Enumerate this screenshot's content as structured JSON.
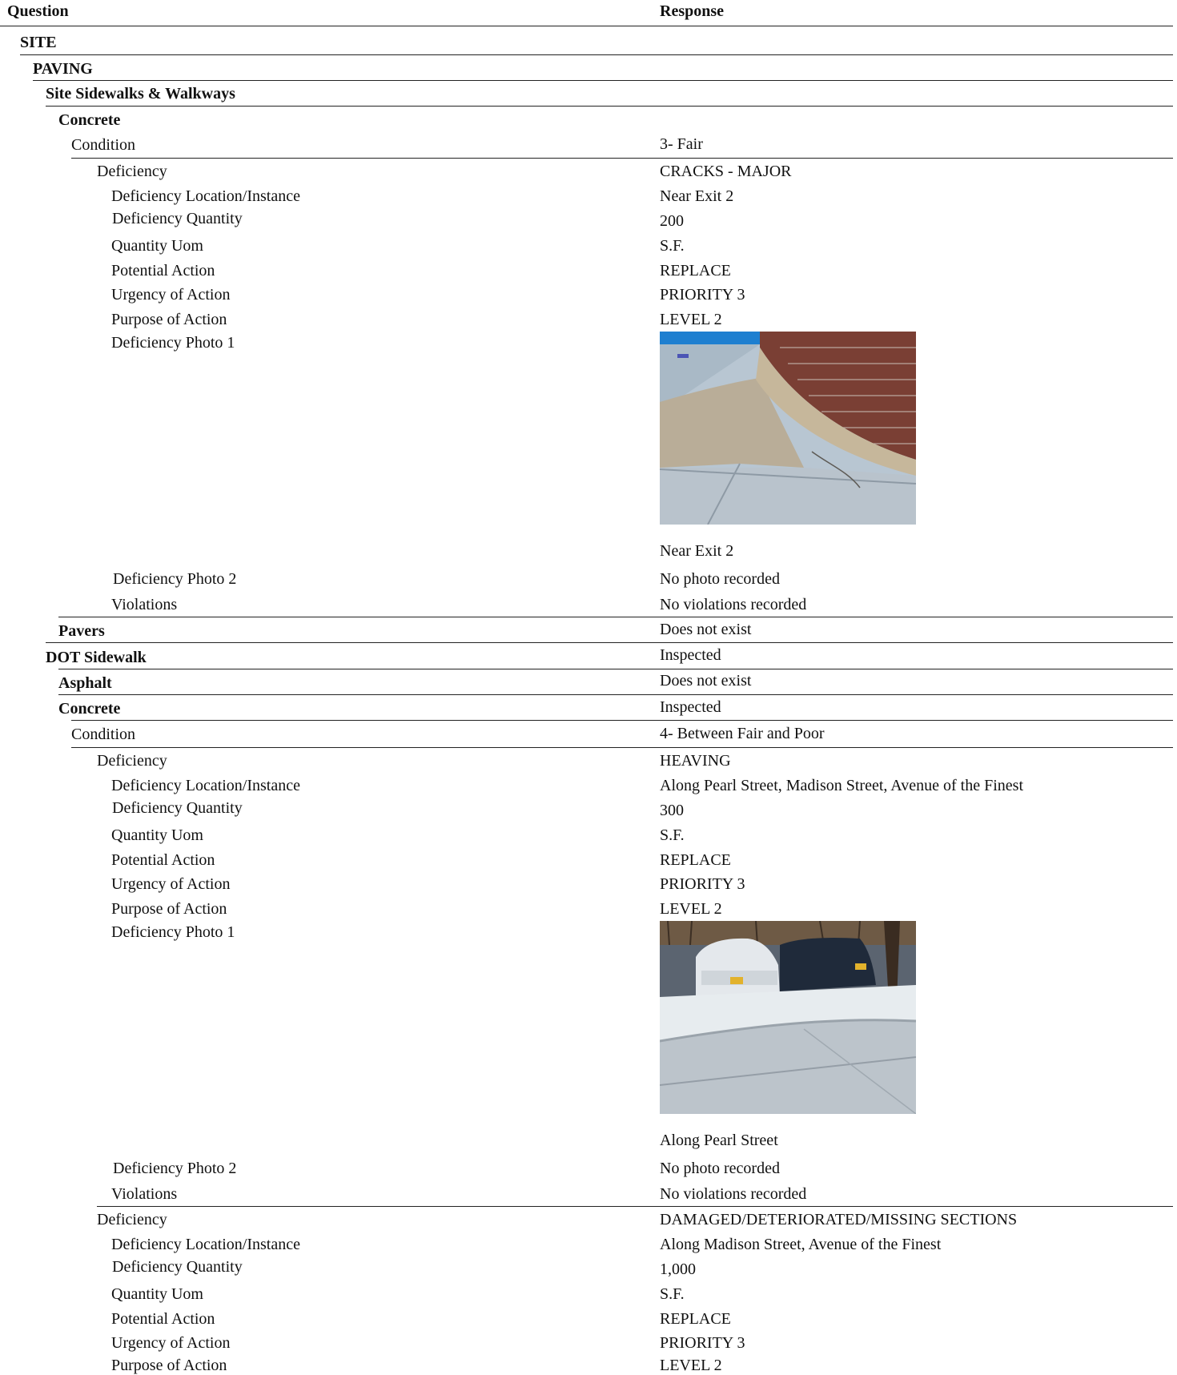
{
  "header": {
    "question": "Question",
    "response": "Response"
  },
  "sections": {
    "site": "SITE",
    "paving": "PAVING",
    "site_sidewalks": "Site Sidewalks & Walkways",
    "concrete_1": "Concrete",
    "pavers": "Pavers",
    "pavers_value": "Does not exist",
    "dot_sidewalk": "DOT Sidewalk",
    "dot_sidewalk_value": "Inspected",
    "asphalt": "Asphalt",
    "asphalt_value": "Does not exist",
    "concrete_2": "Concrete",
    "concrete_2_value": "Inspected"
  },
  "labels": {
    "condition": "Condition",
    "deficiency": "Deficiency",
    "location": "Deficiency Location/Instance",
    "quantity": "Deficiency Quantity",
    "uom": "Quantity Uom",
    "action": "Potential Action",
    "urgency": "Urgency of Action",
    "purpose": "Purpose of Action",
    "photo1": "Deficiency Photo 1",
    "photo2": "Deficiency Photo 2",
    "violations": "Violations"
  },
  "site_concrete": {
    "condition": "3- Fair",
    "deficiency": "CRACKS - MAJOR",
    "location": "Near Exit 2",
    "quantity": "200",
    "uom": "S.F.",
    "action": "REPLACE",
    "urgency": "PRIORITY 3",
    "purpose": "LEVEL 2",
    "photo1_caption": "Near Exit 2",
    "photo2": "No photo recorded",
    "violations": "No violations recorded"
  },
  "dot_concrete": {
    "condition": "4- Between Fair and Poor",
    "deficiency_1": {
      "deficiency": "HEAVING",
      "location": "Along Pearl Street, Madison Street, Avenue of the Finest",
      "quantity": "300",
      "uom": "S.F.",
      "action": "REPLACE",
      "urgency": "PRIORITY 3",
      "purpose": "LEVEL 2",
      "photo1_caption": "Along Pearl Street",
      "photo2": "No photo recorded",
      "violations": "No violations recorded"
    },
    "deficiency_2": {
      "deficiency": "DAMAGED/DETERIORATED/MISSING SECTIONS",
      "location": "Along Madison Street, Avenue of the Finest",
      "quantity": "1,000",
      "uom": "S.F.",
      "action": "REPLACE",
      "urgency": "PRIORITY 3",
      "purpose": "LEVEL 2"
    }
  }
}
